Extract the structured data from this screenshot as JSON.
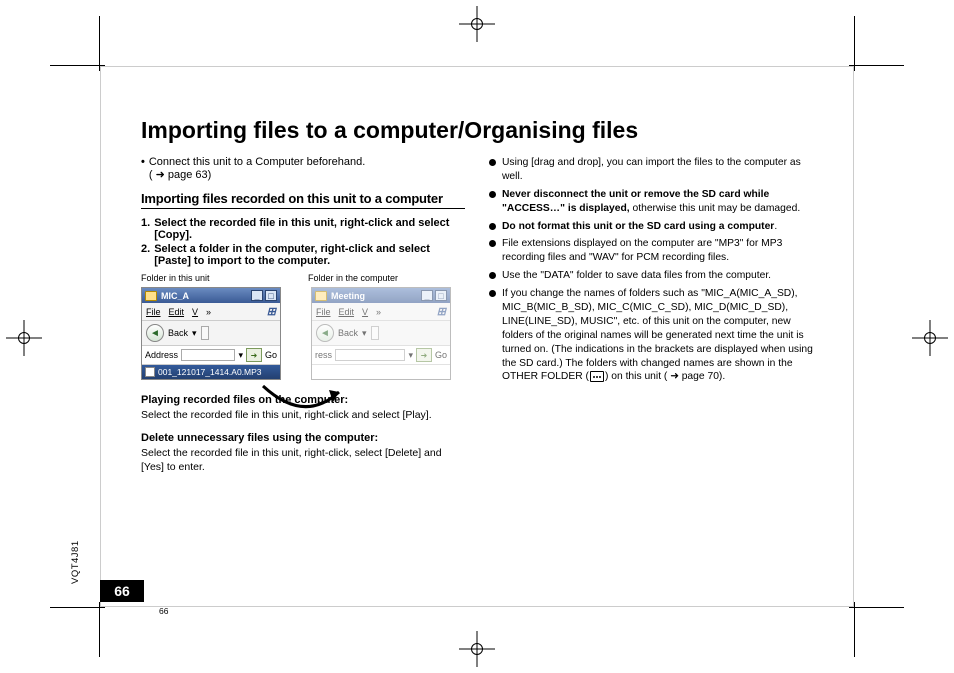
{
  "title": "Importing files to a computer/Organising files",
  "note_prefix": "Connect this unit to a Computer beforehand.",
  "note_page_ref": "( ➜ page 63)",
  "section1_heading": "Importing files recorded on this unit to a computer",
  "step1_num": "1.",
  "step1_text": "Select the recorded file in this unit, right-click and select [Copy].",
  "step2_num": "2.",
  "step2_text": "Select a folder in the computer, right-click and select [Paste] to import to the computer.",
  "caption_left": "Folder in this unit",
  "caption_right": "Folder in the computer",
  "win1": {
    "title": "MIC_A",
    "menu_file": "File",
    "menu_edit": "Edit",
    "menu_view": "V",
    "menu_more": "»",
    "back_label": "Back",
    "addr_label": "Address",
    "go_label": "Go",
    "selected_file": "001_121017_1414.A0.MP3"
  },
  "win2": {
    "title": "Meeting",
    "menu_file": "File",
    "menu_edit": "Edit",
    "menu_view": "V",
    "menu_more": "»",
    "back_label": "Back",
    "addr_label": "ress",
    "go_label": "Go"
  },
  "subhead_play": "Playing recorded files on the computer:",
  "body_play": "Select the recorded file in this unit, right-click and select [Play].",
  "subhead_delete": "Delete unnecessary files using the computer:",
  "body_delete": "Select the recorded file in this unit, right-click, select [Delete] and [Yes] to enter.",
  "r1": "Using [drag and drop], you can import the files to the computer as well.",
  "r2a": "Never disconnect the unit or remove the SD card while \"ACCESS…\" is displayed,",
  "r2b": " otherwise this unit may be damaged.",
  "r3a": "Do not format this unit or the SD card using a computer",
  "r3b": ".",
  "r4": "File extensions displayed on the computer are \"MP3\" for MP3 recording files and \"WAV\" for PCM recording files.",
  "r5": "Use the \"DATA\" folder to save data files from the computer.",
  "r6a": "If you change the names of folders such as \"MIC_A(MIC_A_SD), MIC_B(MIC_B_SD), MIC_C(MIC_C_SD), MIC_D(MIC_D_SD), LINE(LINE_SD), MUSIC\", etc. of this unit on the computer, new folders of the original names will be generated next time the unit is turned on. (The indications in the brackets are displayed when using the SD card.) The folders with changed names are shown in the OTHER FOLDER (",
  "r6b": ") on this unit ( ➜ page 70).",
  "vert_code": "VQT4J81",
  "page_number": "66",
  "page_number_small": "66"
}
